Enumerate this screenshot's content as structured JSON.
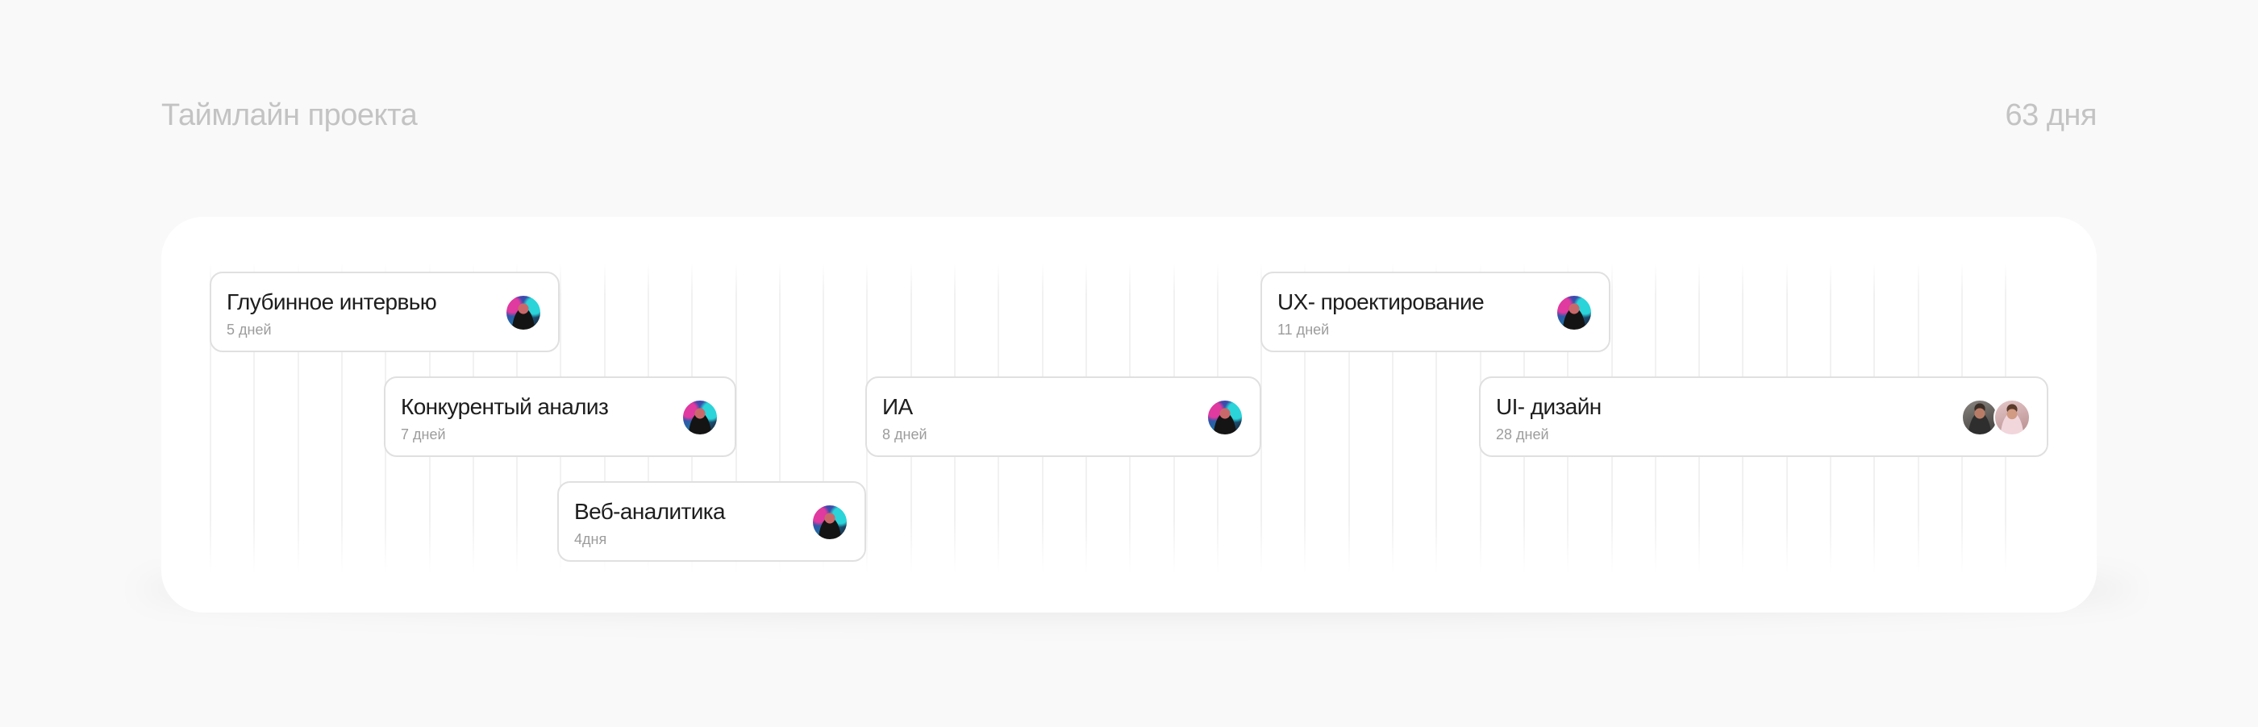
{
  "header": {
    "title": "Таймлайн проекта",
    "total_duration": "63 дня"
  },
  "tasks": [
    {
      "name": "Глубинное интервью",
      "duration": "5 дней",
      "assignees": [
        "avatar-a"
      ]
    },
    {
      "name": "Конкурентый анализ",
      "duration": "7 дней",
      "assignees": [
        "avatar-a"
      ]
    },
    {
      "name": "Веб-аналитика",
      "duration": "4дня",
      "assignees": [
        "avatar-a"
      ]
    },
    {
      "name": "ИА",
      "duration": "8 дней",
      "assignees": [
        "avatar-a"
      ]
    },
    {
      "name": "UX- проектирование",
      "duration": "11 дней",
      "assignees": [
        "avatar-a"
      ]
    },
    {
      "name": "UI- дизайн",
      "duration": "28 дней",
      "assignees": [
        "avatar-b",
        "avatar-c"
      ]
    }
  ]
}
